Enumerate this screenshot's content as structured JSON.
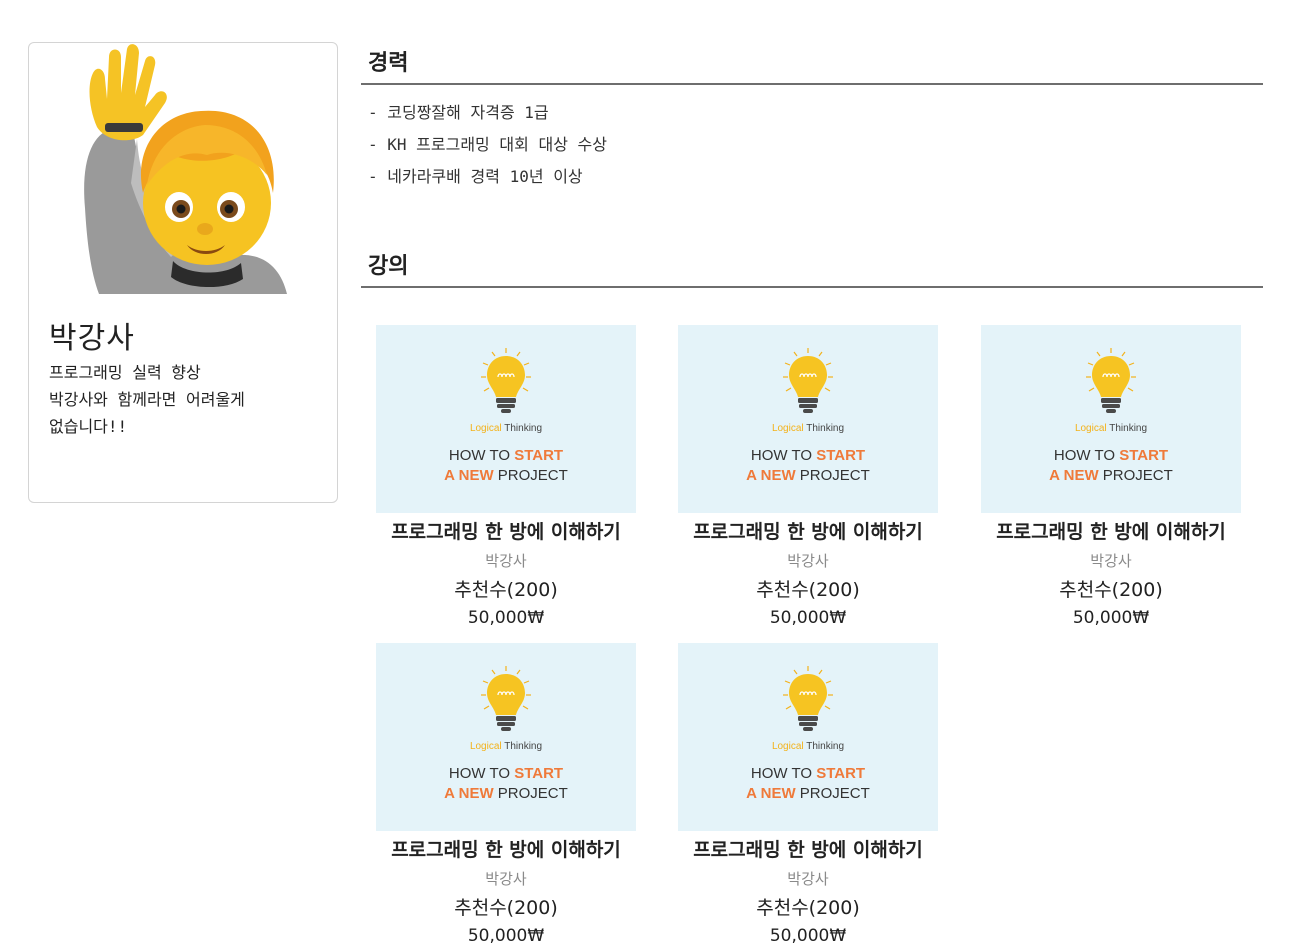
{
  "profile": {
    "name": "박강사",
    "intro": "프로그래밍 실력 향상\n박강사와 함께라면 어려울게\n없습니다!!"
  },
  "career": {
    "title": "경력",
    "items": [
      "- 코딩짱잘해 자격증 1급",
      "- KH 프로그래밍 대회 대상 수상",
      "- 네카라쿠배 경력 10년 이상"
    ]
  },
  "lectures": {
    "title": "강의",
    "thumbnail": {
      "caption_highlight": "Logical",
      "caption_rest": " Thinking",
      "line1_a": "HOW TO ",
      "line1_b": "START",
      "line2_a": "A NEW",
      "line2_b": " PROJECT",
      "bulb_color": "#f6c422",
      "accent_color": "#ef7a3a",
      "bg_color": "#e4f3f9"
    },
    "courses": [
      {
        "title": "프로그래밍 한 방에 이해하기",
        "teacher": "박강사",
        "likes": "추천수(200)",
        "price": "50,000₩"
      },
      {
        "title": "프로그래밍 한 방에 이해하기",
        "teacher": "박강사",
        "likes": "추천수(200)",
        "price": "50,000₩"
      },
      {
        "title": "프로그래밍 한 방에 이해하기",
        "teacher": "박강사",
        "likes": "추천수(200)",
        "price": "50,000₩"
      },
      {
        "title": "프로그래밍 한 방에 이해하기",
        "teacher": "박강사",
        "likes": "추천수(200)",
        "price": "50,000₩"
      },
      {
        "title": "프로그래밍 한 방에 이해하기",
        "teacher": "박강사",
        "likes": "추천수(200)",
        "price": "50,000₩"
      }
    ]
  }
}
